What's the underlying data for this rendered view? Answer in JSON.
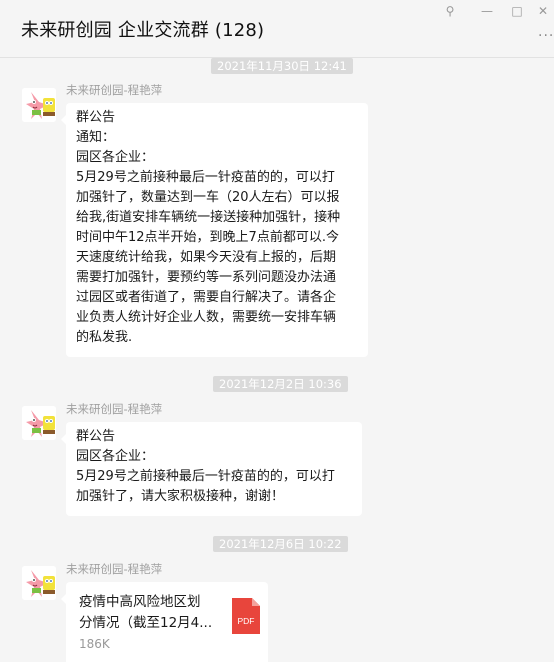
{
  "window": {
    "title": "未来研创园   企业交流群 (128)",
    "controls": {
      "pin": "⚲",
      "minimize": "—",
      "maximize": "□",
      "close": "✕",
      "more": "···"
    }
  },
  "messages": [
    {
      "time": "2021年11月30日 12:41",
      "sender": "未来研创园-程艳萍",
      "avatar_icon": "patrick-star-avatar",
      "lines": [
        "群公告",
        "通知：",
        "园区各企业：",
        "5月29号之前接种最后一针疫苗的的，可以打",
        "加强针了，数量达到一车（20人左右）可以报",
        "给我,街道安排车辆统一接送接种加强针，接种",
        "时间中午12点半开始，到晚上7点前都可以.今",
        "天速度统计给我，如果今天没有上报的，后期",
        "需要打加强针，要预约等一系列问题没办法通",
        "过园区或者街道了，需要自行解决了。请各企",
        "业负责人统计好企业人数，需要统一安排车辆",
        "的私发我."
      ]
    },
    {
      "time": "2021年12月2日 10:36",
      "sender": "未来研创园-程艳萍",
      "avatar_icon": "patrick-star-avatar",
      "lines": [
        "群公告",
        "园区各企业：",
        "5月29号之前接种最后一针疫苗的的，可以打",
        "加强针了，请大家积极接种，谢谢！"
      ]
    },
    {
      "time": "2021年12月6日 10:22",
      "sender": "未来研创园-程艳萍",
      "avatar_icon": "patrick-star-avatar",
      "file": {
        "name_lines": [
          "疫情中高风险地区划",
          "分情况（截至12月4..."
        ],
        "size": "186K",
        "type_label": "PDF",
        "icon": "pdf-file-icon",
        "icon_color": "#e8453c"
      }
    }
  ],
  "colors": {
    "background": "#f5f5f5",
    "bubble": "#ffffff",
    "timestamp_bg": "#dadada",
    "pdf": "#e8453c"
  }
}
